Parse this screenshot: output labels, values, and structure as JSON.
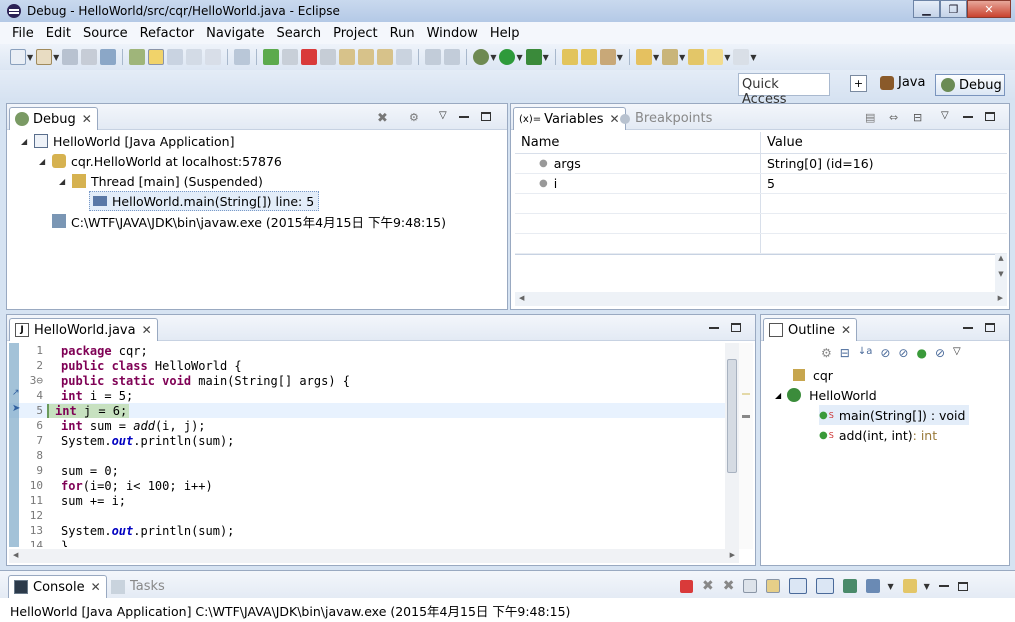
{
  "window": {
    "title": "Debug - HelloWorld/src/cqr/HelloWorld.java - Eclipse"
  },
  "menu": [
    "File",
    "Edit",
    "Source",
    "Refactor",
    "Navigate",
    "Search",
    "Project",
    "Run",
    "Window",
    "Help"
  ],
  "perspective": {
    "quick_access": "Quick Access",
    "java": "Java",
    "debug": "Debug"
  },
  "debug_view": {
    "tab": "Debug",
    "items": [
      "HelloWorld [Java Application]",
      "cqr.HelloWorld at localhost:57876",
      "Thread [main] (Suspended)",
      "HelloWorld.main(String[]) line: 5",
      "C:\\WTF\\JAVA\\JDK\\bin\\javaw.exe (2015年4月15日 下午9:48:15)"
    ]
  },
  "variables_view": {
    "tab_variables": "Variables",
    "tab_breakpoints": "Breakpoints",
    "col_name": "Name",
    "col_value": "Value",
    "rows": [
      {
        "name": "args",
        "value": "String[0]  (id=16)"
      },
      {
        "name": "i",
        "value": "5"
      }
    ]
  },
  "editor": {
    "tab": "HelloWorld.java",
    "lines": [
      {
        "n": "1",
        "text": "package cqr;"
      },
      {
        "n": "2",
        "text": "public class HelloWorld {"
      },
      {
        "n": "3⊖",
        "text": "public static void main(String[] args) {"
      },
      {
        "n": "4",
        "text": "int i = 5;"
      },
      {
        "n": "5",
        "text": "int j = 6;"
      },
      {
        "n": "6",
        "text": "int sum = add(i, j);"
      },
      {
        "n": "7",
        "text": "System.out.println(sum);"
      },
      {
        "n": "8",
        "text": ""
      },
      {
        "n": "9",
        "text": "sum = 0;"
      },
      {
        "n": "10",
        "text": "for(i=0; i< 100; i++)"
      },
      {
        "n": "11",
        "text": "sum += i;"
      },
      {
        "n": "12",
        "text": ""
      },
      {
        "n": "13",
        "text": "System.out.println(sum);"
      },
      {
        "n": "14",
        "text": "}"
      }
    ]
  },
  "outline_view": {
    "tab": "Outline",
    "items": [
      {
        "label": "cqr",
        "suffix": ""
      },
      {
        "label": "HelloWorld",
        "suffix": ""
      },
      {
        "label": "main(String[]) : void",
        "suffix": ""
      },
      {
        "label": "add(int, int)",
        "suffix": " : int"
      }
    ]
  },
  "console_view": {
    "tab_console": "Console",
    "tab_tasks": "Tasks",
    "text": "HelloWorld [Java Application] C:\\WTF\\JAVA\\JDK\\bin\\javaw.exe (2015年4月15日 下午9:48:15)"
  },
  "colors": {
    "accent": "#7ca8c8",
    "keyword": "#7f0055",
    "exec_line": "#c7e1c0"
  }
}
